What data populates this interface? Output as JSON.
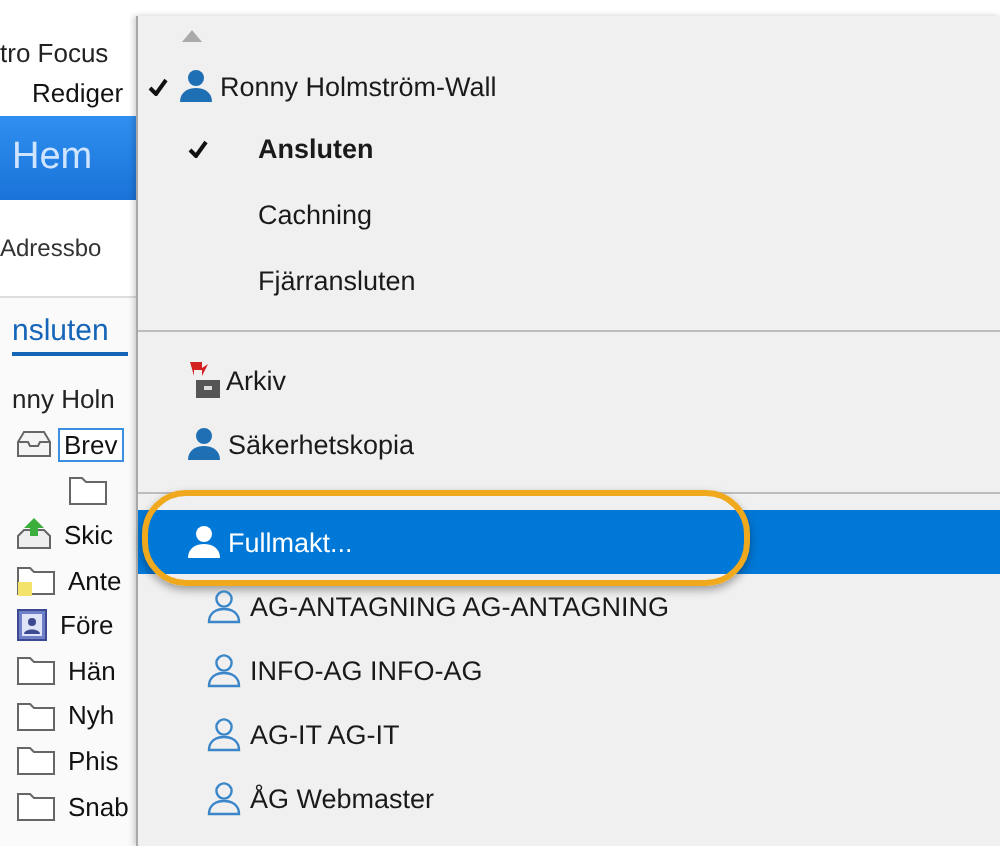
{
  "app": {
    "title": "tro Focus",
    "menu": "Rediger",
    "ribbon_tab": "Hem",
    "address": "Adressbo",
    "view_tab": "nsluten",
    "account": "nny Holn",
    "folders": [
      {
        "label": "Brev",
        "kind": "inbox",
        "selected": true
      },
      {
        "kind": "subfolder",
        "selected": false
      },
      {
        "label": "Skic",
        "kind": "outbox",
        "selected": false
      },
      {
        "label": "Ante",
        "kind": "notes",
        "selected": false
      },
      {
        "label": "Före",
        "kind": "contacts",
        "selected": false
      },
      {
        "label": "Hän",
        "kind": "folder",
        "selected": false
      },
      {
        "label": "Nyh",
        "kind": "folder",
        "selected": false
      },
      {
        "label": "Phis",
        "kind": "folder",
        "selected": false
      },
      {
        "label": "Snab",
        "kind": "folder",
        "selected": false
      }
    ]
  },
  "context_menu": {
    "items": [
      {
        "kind": "scroll-up"
      },
      {
        "kind": "account",
        "label": "Ronny Holmström-Wall",
        "checked": true
      },
      {
        "kind": "status",
        "label": "Ansluten",
        "checked": true
      },
      {
        "kind": "status",
        "label": "Cachning",
        "checked": false
      },
      {
        "kind": "status",
        "label": "Fjärransluten",
        "checked": false
      },
      {
        "kind": "separator"
      },
      {
        "kind": "archive",
        "label": "Arkiv",
        "selected": false,
        "highlighted": false
      },
      {
        "kind": "backup",
        "label": "Säkerhetskopia",
        "selected": false,
        "highlighted": false
      },
      {
        "kind": "separator"
      },
      {
        "kind": "proxy",
        "label": "Fullmakt...",
        "selected": true,
        "highlighted": true
      },
      {
        "kind": "delegate",
        "label": "AG-ANTAGNING AG-ANTAGNING"
      },
      {
        "kind": "delegate",
        "label": "INFO-AG INFO-AG"
      },
      {
        "kind": "delegate",
        "label": "AG-IT AG-IT"
      },
      {
        "kind": "delegate",
        "label": "ÅG Webmaster"
      }
    ]
  }
}
